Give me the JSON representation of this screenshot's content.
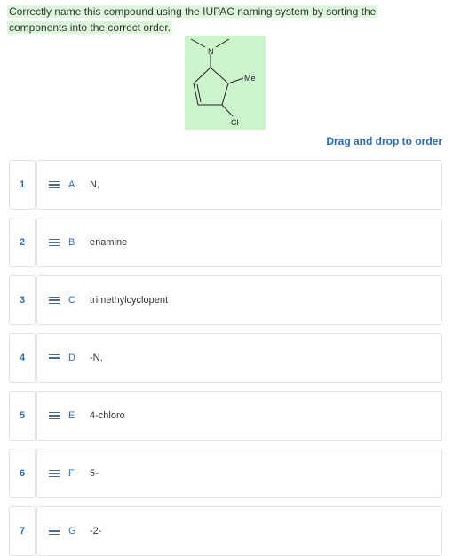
{
  "question": {
    "text": "Correctly name this compound using the IUPAC naming system by sorting the components into the correct order."
  },
  "structure": {
    "atom_labels": {
      "n": "N",
      "me": "Me",
      "cl": "Cl"
    }
  },
  "order_hint": "Drag and drop to order",
  "rows": [
    {
      "num": "1",
      "letter": "A",
      "label": "N,"
    },
    {
      "num": "2",
      "letter": "B",
      "label": "enamine"
    },
    {
      "num": "3",
      "letter": "C",
      "label": "trimethylcyclopent"
    },
    {
      "num": "4",
      "letter": "D",
      "label": "-N,"
    },
    {
      "num": "5",
      "letter": "E",
      "label": "4-chloro"
    },
    {
      "num": "6",
      "letter": "F",
      "label": "5-"
    },
    {
      "num": "7",
      "letter": "G",
      "label": "-2-"
    }
  ]
}
